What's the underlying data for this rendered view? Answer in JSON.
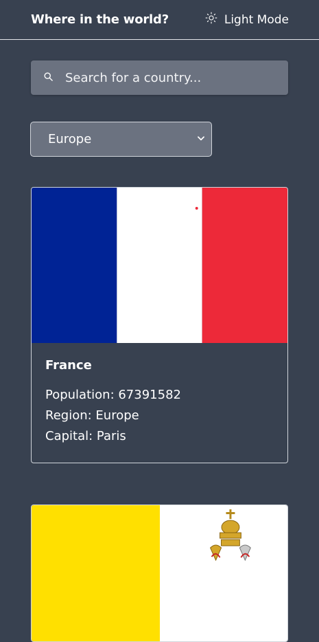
{
  "header": {
    "title": "Where in the world?",
    "mode_label": "Light Mode",
    "mode_icon": "sun-icon"
  },
  "search": {
    "placeholder": "Search for a country...",
    "icon": "search-icon"
  },
  "filter": {
    "selected": "Europe",
    "icon": "chevron-down-icon"
  },
  "countries": [
    {
      "name": "France",
      "population_label": "Population: 67391582",
      "region_label": "Region: Europe",
      "capital_label": "Capital: Paris",
      "flag_colors": [
        "#002395",
        "#ffffff",
        "#ed2939"
      ]
    },
    {
      "flag_colors": [
        "#ffe000",
        "#ffffff"
      ]
    }
  ]
}
